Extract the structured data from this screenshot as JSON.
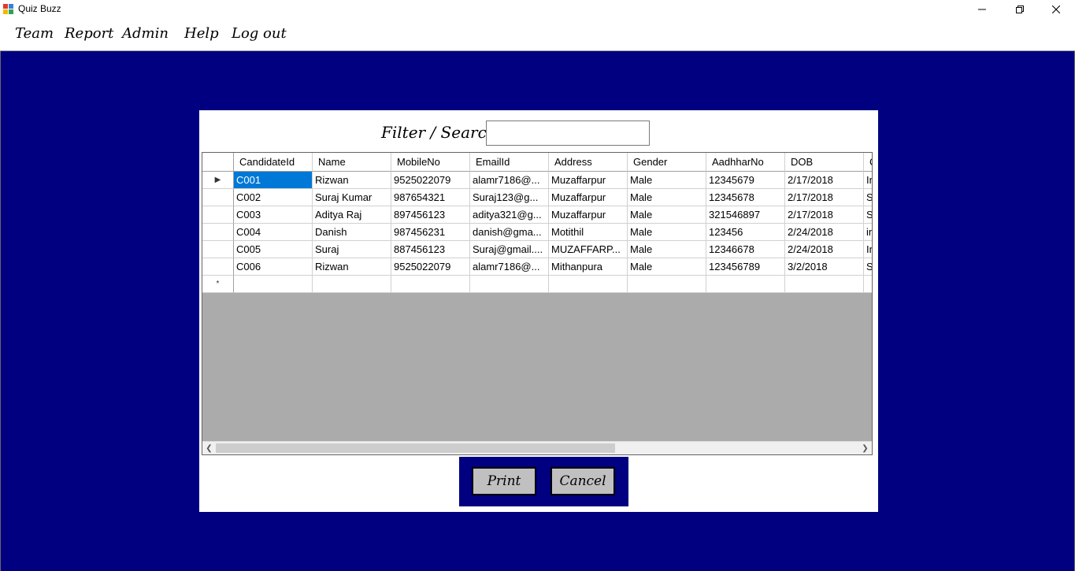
{
  "window": {
    "title": "Quiz Buzz"
  },
  "menu": [
    "Team",
    "Report",
    "Admin",
    "Help",
    "Log out"
  ],
  "search": {
    "label": "Filter / Search",
    "value": ""
  },
  "grid": {
    "columns": [
      "CandidateId",
      "Name",
      "MobileNo",
      "EmailId",
      "Address",
      "Gender",
      "AadhharNo",
      "DOB",
      "C"
    ],
    "rows": [
      [
        "C001",
        "Rizwan",
        "9525022079",
        "alamr7186@...",
        "Muzaffarpur",
        "Male",
        "12345679",
        "2/17/2018",
        "In"
      ],
      [
        "C002",
        "Suraj Kumar",
        "987654321",
        "Suraj123@g...",
        "Muzaffarpur",
        "Male",
        "12345678",
        "2/17/2018",
        "S"
      ],
      [
        "C003",
        "Aditya Raj",
        "897456123",
        "aditya321@g...",
        "Muzaffarpur",
        "Male",
        "321546897",
        "2/17/2018",
        "S"
      ],
      [
        "C004",
        "Danish",
        "987456231",
        "danish@gma...",
        "Motithil",
        "Male",
        "123456",
        "2/24/2018",
        "in"
      ],
      [
        "C005",
        "Suraj",
        "887456123",
        "Suraj@gmail....",
        "MUZAFFARP...",
        "Male",
        "12346678",
        "2/24/2018",
        "In"
      ],
      [
        "C006",
        "Rizwan",
        "9525022079",
        "alamr7186@...",
        "Mithanpura",
        "Male",
        "123456789",
        "3/2/2018",
        "S"
      ]
    ],
    "current_row_marker": "▶",
    "new_row_marker": "*"
  },
  "buttons": {
    "print": "Print",
    "cancel": "Cancel"
  },
  "colors": {
    "background": "#000080",
    "grid_empty": "#ababab",
    "selection": "#0078d7",
    "button": "#c0c0c0"
  }
}
